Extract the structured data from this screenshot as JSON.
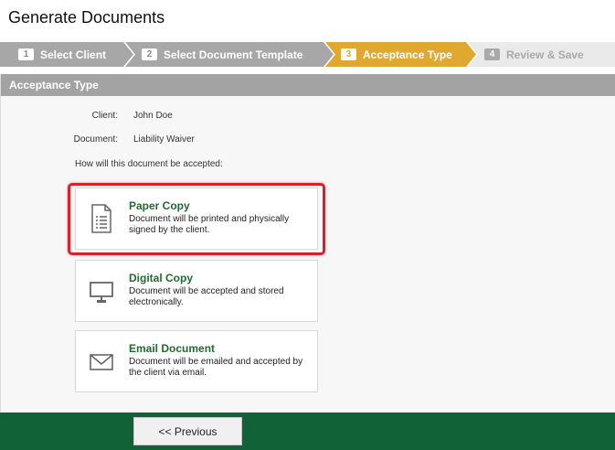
{
  "page": {
    "title": "Generate Documents"
  },
  "wizard": {
    "steps": [
      {
        "num": "1",
        "label": "Select Client"
      },
      {
        "num": "2",
        "label": "Select Document Template"
      },
      {
        "num": "3",
        "label": "Acceptance Type"
      },
      {
        "num": "4",
        "label": "Review & Save"
      }
    ]
  },
  "panel": {
    "header": "Acceptance Type",
    "client_label": "Client:",
    "client_value": "John Doe",
    "document_label": "Document:",
    "document_value": "Liability Waiver",
    "question": "How will this document be accepted:"
  },
  "options": [
    {
      "title": "Paper Copy",
      "desc": "Document will be printed and physically signed by the client.",
      "icon": "document-list-icon"
    },
    {
      "title": "Digital Copy",
      "desc": "Document will be accepted and stored electronically.",
      "icon": "monitor-icon"
    },
    {
      "title": "Email Document",
      "desc": "Document will be emailed and accepted by the client via email.",
      "icon": "envelope-icon"
    }
  ],
  "footer": {
    "previous_label": "<< Previous"
  },
  "colors": {
    "active_step": "#e0a82e",
    "footer": "#126237",
    "title_green": "#1f6b30",
    "highlight": "#d8202b"
  }
}
